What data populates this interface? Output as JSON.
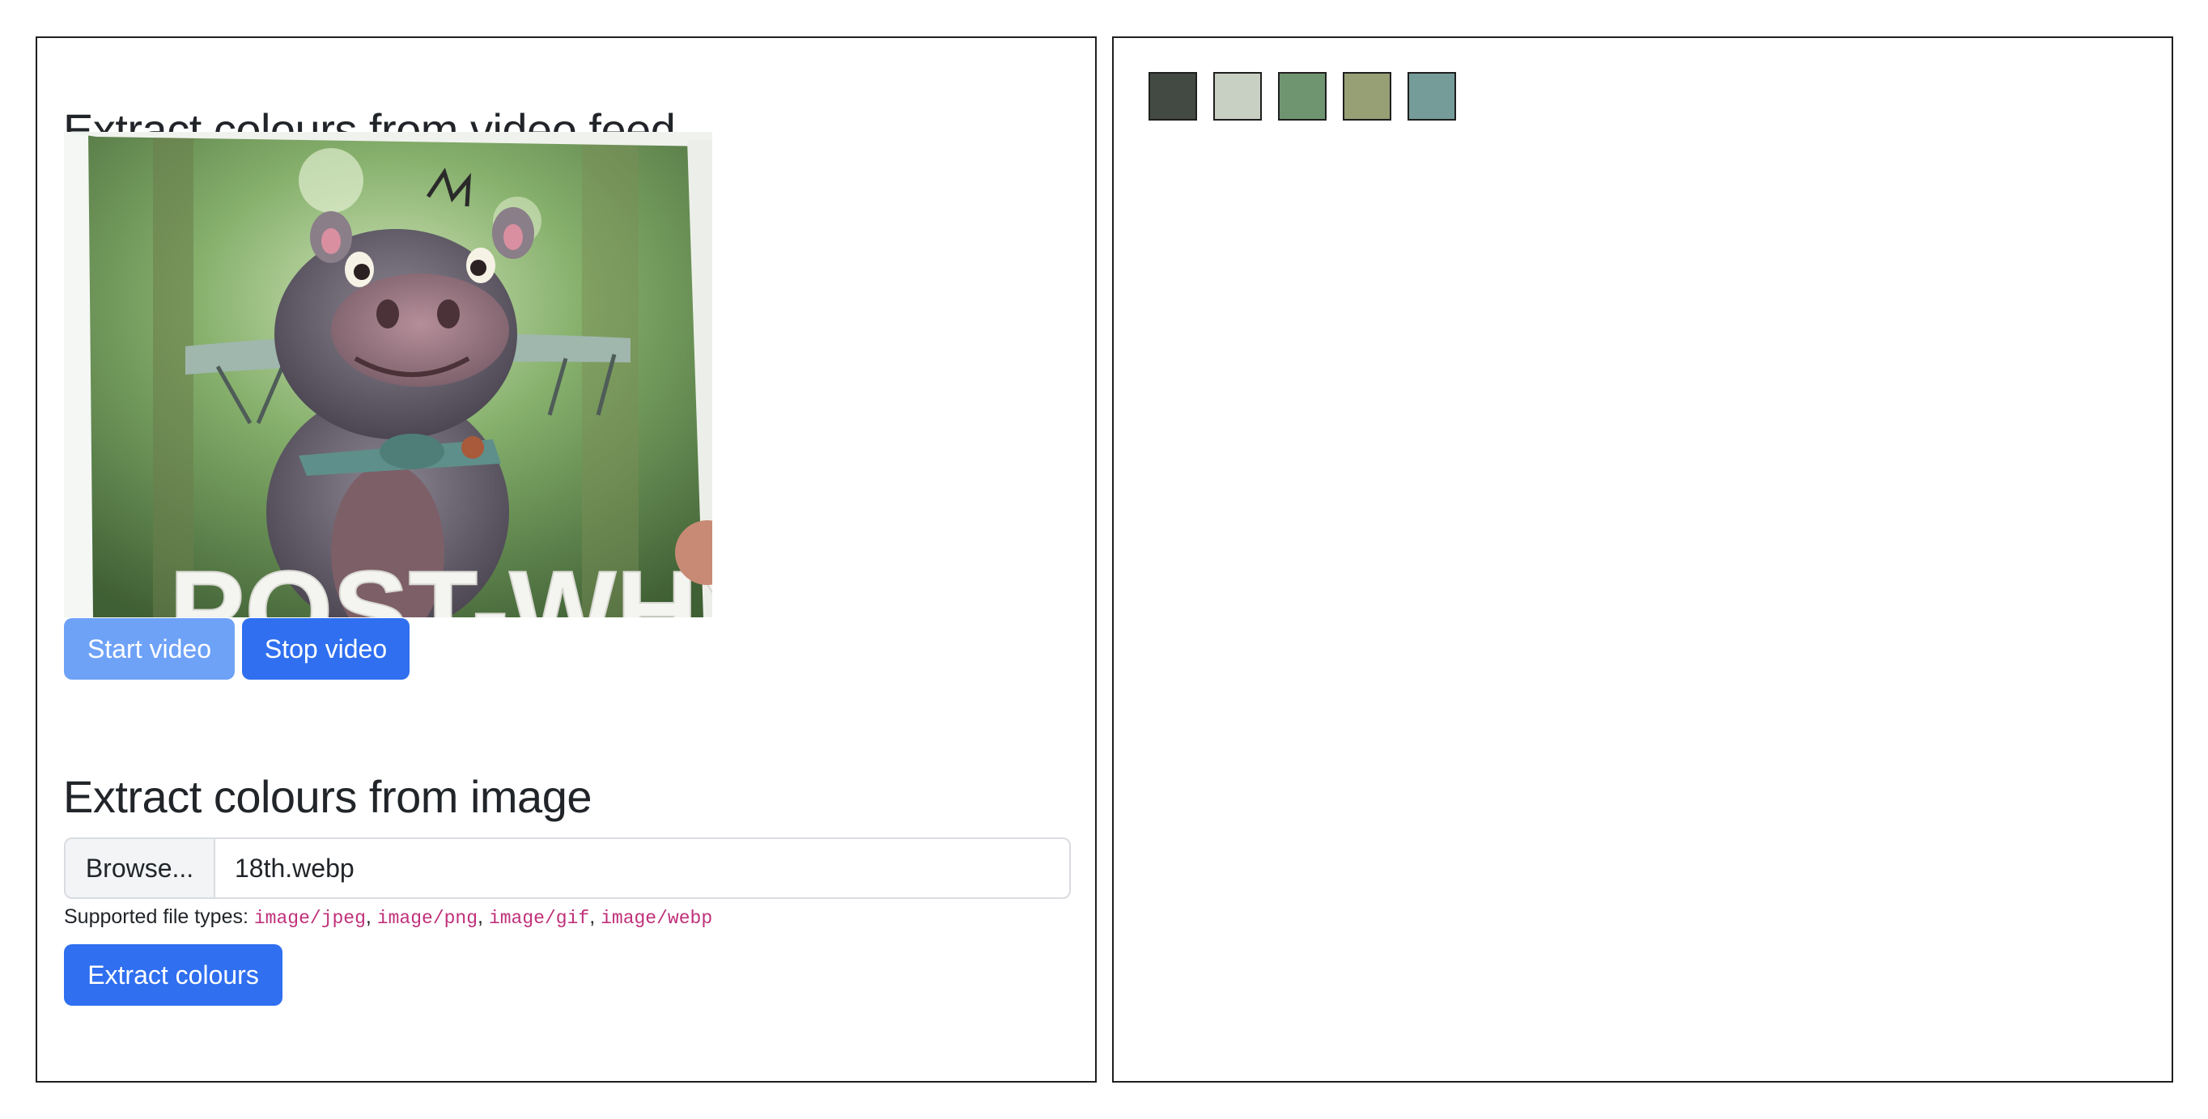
{
  "video_section": {
    "title": "Extract colours from video feed",
    "start_label": "Start video",
    "stop_label": "Stop video",
    "frame_caption": "POST-WHY"
  },
  "image_section": {
    "title": "Extract colours from image",
    "browse_label": "Browse...",
    "file_name": "18th.webp",
    "help_prefix": "Supported file types: ",
    "file_types": [
      "image/jpeg",
      "image/png",
      "image/gif",
      "image/webp"
    ],
    "extract_label": "Extract colours"
  },
  "palette": {
    "colors": [
      "#434a43",
      "#c7d0c2",
      "#6f9470",
      "#979f75",
      "#759c98"
    ]
  }
}
